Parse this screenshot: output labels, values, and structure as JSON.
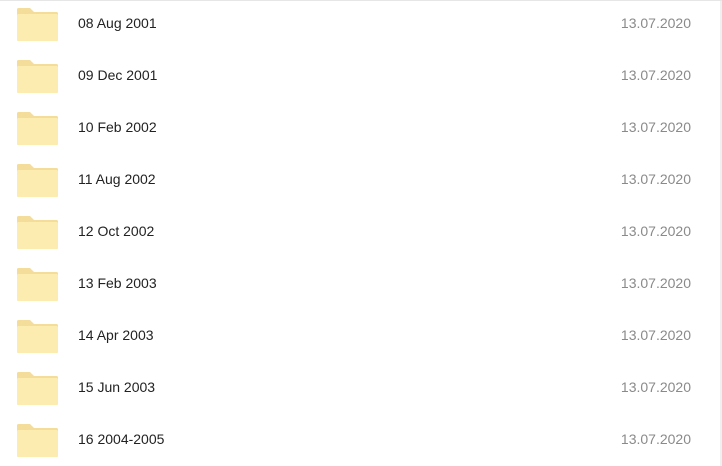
{
  "files": [
    {
      "name": "08 Aug 2001",
      "date": "13.07.2020",
      "icon": "folder-icon"
    },
    {
      "name": "09 Dec 2001",
      "date": "13.07.2020",
      "icon": "folder-icon"
    },
    {
      "name": "10 Feb 2002",
      "date": "13.07.2020",
      "icon": "folder-icon"
    },
    {
      "name": "11 Aug 2002",
      "date": "13.07.2020",
      "icon": "folder-icon"
    },
    {
      "name": "12 Oct 2002",
      "date": "13.07.2020",
      "icon": "folder-icon"
    },
    {
      "name": "13 Feb 2003",
      "date": "13.07.2020",
      "icon": "folder-icon"
    },
    {
      "name": "14 Apr 2003",
      "date": "13.07.2020",
      "icon": "folder-icon"
    },
    {
      "name": "15 Jun 2003",
      "date": "13.07.2020",
      "icon": "folder-icon"
    },
    {
      "name": "16 2004-2005",
      "date": "13.07.2020",
      "icon": "folder-icon"
    }
  ],
  "colors": {
    "folder_fill": "#fcecb0",
    "folder_tab": "#f6dfa0",
    "name_text": "#222222",
    "date_text": "#8a8a8a"
  }
}
